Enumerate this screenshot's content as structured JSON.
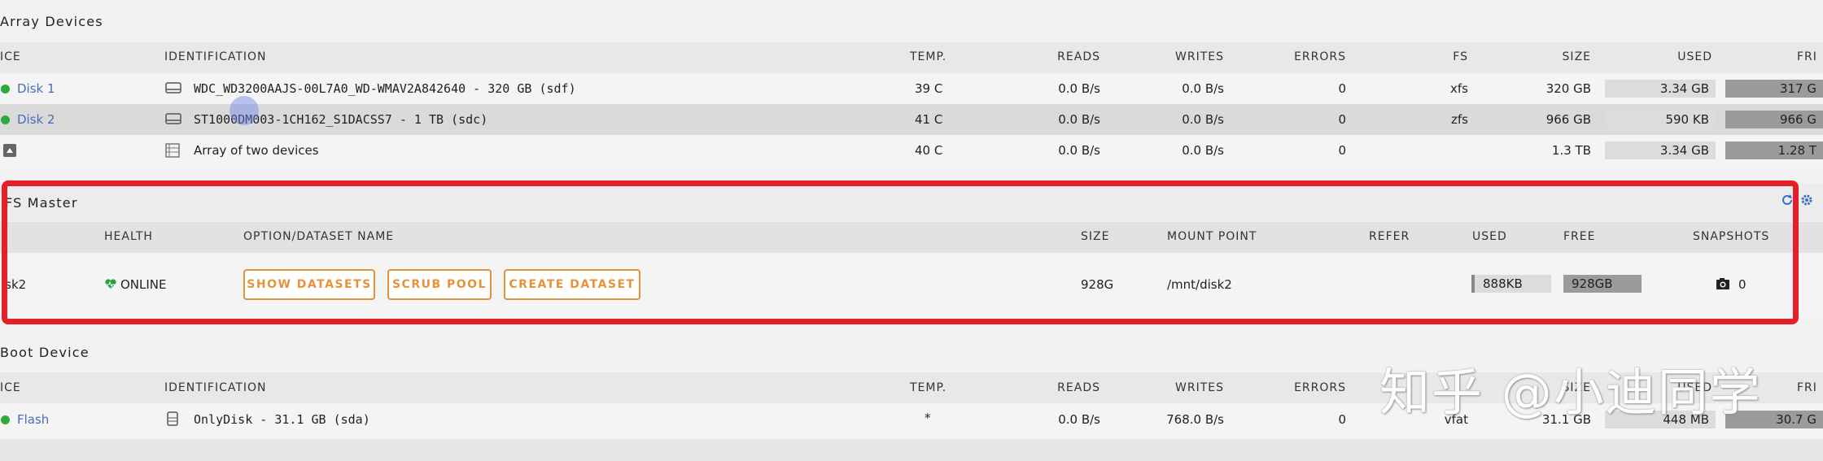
{
  "array": {
    "title": "Array Devices",
    "headers": {
      "device": "ICE",
      "identification": "IDENTIFICATION",
      "temp": "TEMP.",
      "reads": "READS",
      "writes": "WRITES",
      "errors": "ERRORS",
      "fs": "FS",
      "size": "SIZE",
      "used": "USED",
      "free": "FRI"
    },
    "rows": [
      {
        "device": "Disk 1",
        "identification": "WDC_WD3200AAJS-00L7A0_WD-WMAV2A842640 - 320 GB (sdf)",
        "temp": "39 C",
        "reads": "0.0 B/s",
        "writes": "0.0 B/s",
        "errors": "0",
        "fs": "xfs",
        "size": "320 GB",
        "used": "3.34 GB",
        "free": "317 G"
      },
      {
        "device": "Disk 2",
        "identification": "ST1000DM003-1CH162_S1DACSS7 - 1 TB (sdc)",
        "temp": "41 C",
        "reads": "0.0 B/s",
        "writes": "0.0 B/s",
        "errors": "0",
        "fs": "zfs",
        "size": "966 GB",
        "used": "590 KB",
        "free": "966 G"
      },
      {
        "device": "",
        "identification": "Array of two devices",
        "temp": "40 C",
        "reads": "0.0 B/s",
        "writes": "0.0 B/s",
        "errors": "0",
        "fs": "",
        "size": "1.3 TB",
        "used": "3.34 GB",
        "free": "1.28 T"
      }
    ]
  },
  "zfs": {
    "title": "FS Master",
    "headers": {
      "pool": "",
      "health": "HEALTH",
      "option": "OPTION/DATASET NAME",
      "size": "SIZE",
      "mount": "MOUNT POINT",
      "refer": "REFER",
      "used": "USED",
      "free": "FREE",
      "snapshots": "SNAPSHOTS"
    },
    "row": {
      "pool": "isk2",
      "health": "ONLINE",
      "buttons": [
        "SHOW DATASETS",
        "SCRUB POOL",
        "CREATE DATASET"
      ],
      "size": "928G",
      "mount": "/mnt/disk2",
      "refer": "",
      "used": "888KB",
      "free": "928GB",
      "snapshots": "0"
    }
  },
  "boot": {
    "title": "Boot Device",
    "headers": {
      "device": "ICE",
      "identification": "IDENTIFICATION",
      "temp": "TEMP.",
      "reads": "READS",
      "writes": "WRITES",
      "errors": "ERRORS",
      "fs": "",
      "size": "SIZE",
      "used": "USED",
      "free": "FRI"
    },
    "row": {
      "device": "Flash",
      "identification": "OnlyDisk - 31.1 GB (sda)",
      "temp": "*",
      "reads": "0.0 B/s",
      "writes": "768.0 B/s",
      "errors": "0",
      "fs": "vfat",
      "size": "31.1 GB",
      "used": "448 MB",
      "free": "30.7 G"
    }
  },
  "watermark": "知乎 @小迪同学",
  "colors": {
    "accent": "#e5933a",
    "status_green": "#2eaa3d",
    "link": "#486dba",
    "highlight_box": "#e3202a"
  }
}
